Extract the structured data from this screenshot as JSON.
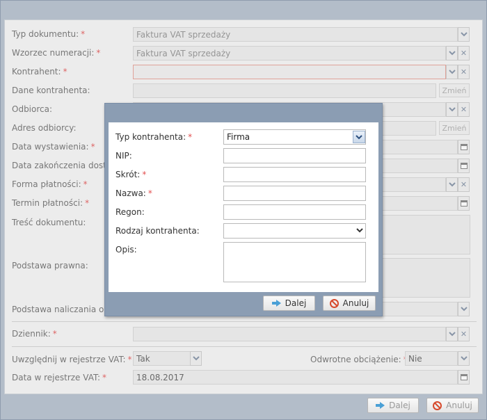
{
  "form": {
    "typ_dokumentu": {
      "label": "Typ dokumentu:",
      "value": "Faktura VAT sprzedaży"
    },
    "wzorzec": {
      "label": "Wzorzec numeracji:",
      "value": "Faktura VAT sprzedaży"
    },
    "kontrahent": {
      "label": "Kontrahent:",
      "value": ""
    },
    "dane_kontrahenta": {
      "label": "Dane kontrahenta:",
      "value": ""
    },
    "odbiorca": {
      "label": "Odbiorca:",
      "value": ""
    },
    "adres_odbiorcy": {
      "label": "Adres odbiorcy:",
      "value": ""
    },
    "data_wystawienia": {
      "label": "Data wystawienia:",
      "value": ""
    },
    "data_zakonczenia": {
      "label": "Data zakończenia dostaw",
      "value": ""
    },
    "forma_platnosci": {
      "label": "Forma płatności:",
      "value": ""
    },
    "termin_platnosci": {
      "label": "Termin płatności:",
      "value": ""
    },
    "tresc_dokumentu": {
      "label": "Treść dokumentu:",
      "value": ""
    },
    "podstawa_prawna": {
      "label": "Podstawa prawna:",
      "value": ""
    },
    "podstawa_naliczania": {
      "label": "Podstawa naliczania odse",
      "value": ""
    },
    "dziennik": {
      "label": "Dziennik:",
      "value": ""
    },
    "rejestr_vat": {
      "label": "Uwzględnij w rejestrze VAT:",
      "value": "Tak"
    },
    "odwrotne": {
      "label": "Odwrotne obciążenie:",
      "value": "Nie"
    },
    "data_rejestr": {
      "label": "Data w rejestrze VAT:",
      "value": "18.08.2017"
    },
    "zmien_label": "Zmień",
    "required_mark": "*"
  },
  "footer": {
    "next_label": "Dalej",
    "cancel_label": "Anuluj"
  },
  "modal": {
    "typ_kontrahenta": {
      "label": "Typ kontrahenta:",
      "value": "Firma"
    },
    "nip": {
      "label": "NIP:",
      "value": ""
    },
    "skrot": {
      "label": "Skrót:",
      "value": ""
    },
    "nazwa": {
      "label": "Nazwa:",
      "value": ""
    },
    "regon": {
      "label": "Regon:",
      "value": ""
    },
    "rodzaj": {
      "label": "Rodzaj kontrahenta:",
      "value": ""
    },
    "opis": {
      "label": "Opis:",
      "value": ""
    },
    "next_label": "Dalej",
    "cancel_label": "Anuluj"
  },
  "icons": {
    "dropdown": "chevron-down-icon",
    "clear": "close-icon",
    "calendar": "calendar-icon",
    "next": "arrow-right-icon",
    "cancel": "cancel-icon"
  },
  "colors": {
    "required": "#e35050",
    "modal_header": "#8b9db3",
    "next_arrow": "#4aa0d6",
    "cancel_icon": "#d74a2d"
  }
}
